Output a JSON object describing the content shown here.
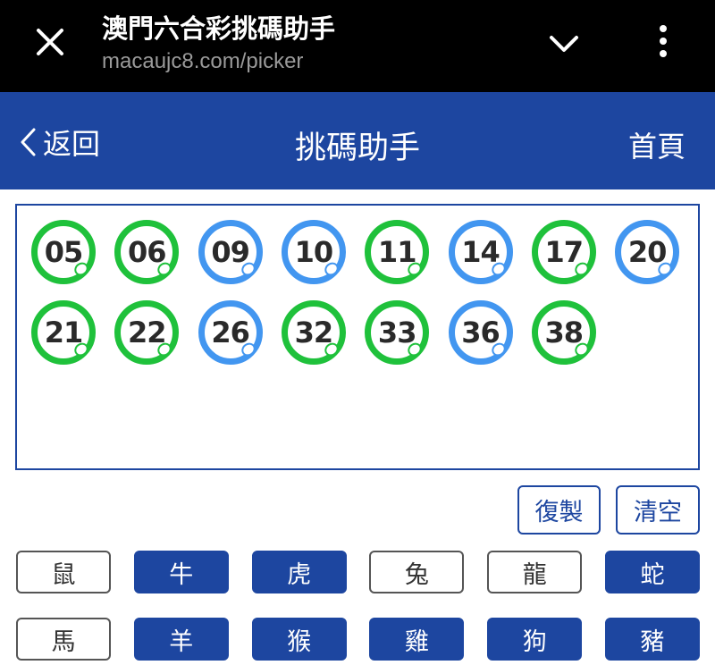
{
  "browser": {
    "page_title": "澳門六合彩挑碼助手",
    "url": "macaujc8.com/picker"
  },
  "header": {
    "back_label": "返回",
    "title": "挑碼助手",
    "home_label": "首頁"
  },
  "picked_numbers": [
    {
      "number": "05",
      "color": "green"
    },
    {
      "number": "06",
      "color": "green"
    },
    {
      "number": "09",
      "color": "blue"
    },
    {
      "number": "10",
      "color": "blue"
    },
    {
      "number": "11",
      "color": "green"
    },
    {
      "number": "14",
      "color": "blue"
    },
    {
      "number": "17",
      "color": "green"
    },
    {
      "number": "20",
      "color": "blue"
    },
    {
      "number": "21",
      "color": "green"
    },
    {
      "number": "22",
      "color": "green"
    },
    {
      "number": "26",
      "color": "blue"
    },
    {
      "number": "32",
      "color": "green"
    },
    {
      "number": "33",
      "color": "green"
    },
    {
      "number": "36",
      "color": "blue"
    },
    {
      "number": "38",
      "color": "green"
    }
  ],
  "actions": {
    "copy_label": "復製",
    "clear_label": "清空"
  },
  "zodiac": [
    {
      "label": "鼠",
      "selected": false
    },
    {
      "label": "牛",
      "selected": true
    },
    {
      "label": "虎",
      "selected": true
    },
    {
      "label": "兔",
      "selected": false
    },
    {
      "label": "龍",
      "selected": false
    },
    {
      "label": "蛇",
      "selected": true
    },
    {
      "label": "馬",
      "selected": false
    },
    {
      "label": "羊",
      "selected": true
    },
    {
      "label": "猴",
      "selected": true
    },
    {
      "label": "雞",
      "selected": true
    },
    {
      "label": "狗",
      "selected": true
    },
    {
      "label": "豬",
      "selected": true
    }
  ],
  "colors": {
    "primary": "#1d46a0",
    "ball_green": "#1fc13b",
    "ball_blue": "#4296f0"
  }
}
